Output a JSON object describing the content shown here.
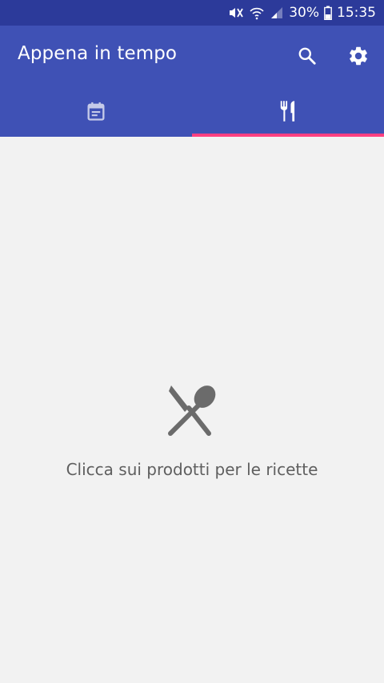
{
  "status_bar": {
    "battery_percent": "30%",
    "time": "15:35",
    "icons": [
      "mute-icon",
      "wifi-icon",
      "signal-icon",
      "battery-icon"
    ]
  },
  "app_bar": {
    "title": "Appena in tempo",
    "actions": [
      "search-icon",
      "settings-icon"
    ]
  },
  "tabs": [
    {
      "icon": "calendar-icon",
      "selected": false
    },
    {
      "icon": "restaurant-icon",
      "selected": true
    }
  ],
  "empty_state": {
    "icon": "spoon-knife-icon",
    "message": "Clicca sui prodotti per le ricette"
  },
  "colors": {
    "status_bar": "#2c3a9a",
    "primary": "#3f51b5",
    "accent": "#ff4081",
    "background": "#f2f2f2",
    "empty_icon": "#6b6b6b",
    "empty_text": "#5f5f5f"
  }
}
